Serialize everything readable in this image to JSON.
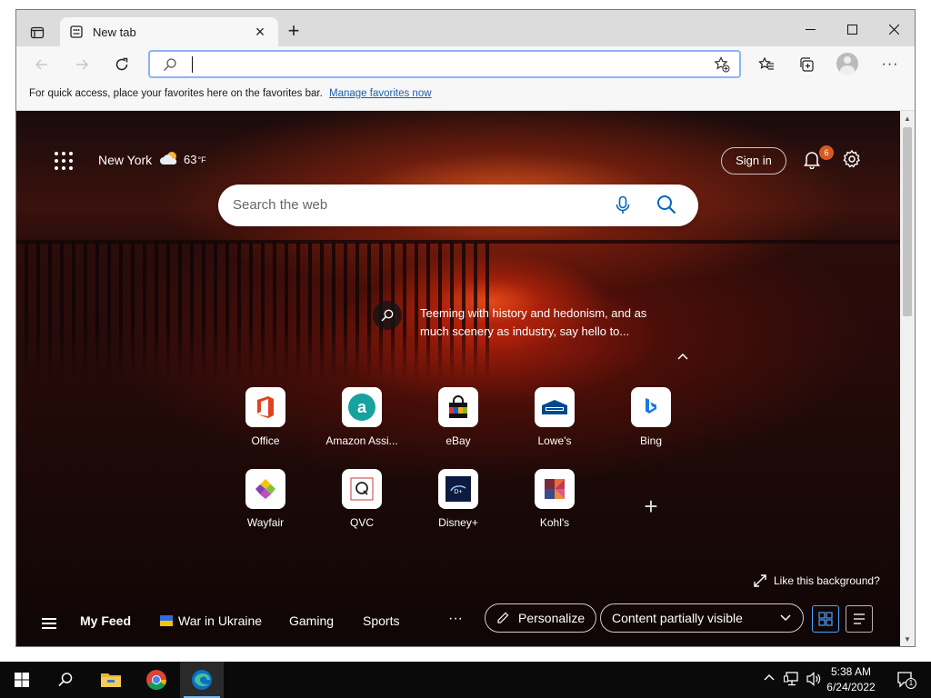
{
  "browser": {
    "tab_title": "New tab",
    "address_value": "",
    "favbar_text": "For quick access, place your favorites here on the favorites bar.",
    "favbar_link": "Manage favorites now"
  },
  "newtab": {
    "city": "New York",
    "temperature": "63",
    "temp_unit": "°F",
    "sign_in": "Sign in",
    "notification_count": "6",
    "search_placeholder": "Search the web",
    "fact_text": "Teeming with history and hedonism, and as much scenery as industry, say hello to...",
    "like_background": "Like this background?",
    "quick_links": [
      {
        "label": "Office",
        "icon": "office-icon"
      },
      {
        "label": "Amazon Assi...",
        "icon": "amazon-icon"
      },
      {
        "label": "eBay",
        "icon": "ebay-icon"
      },
      {
        "label": "Lowe's",
        "icon": "lowes-icon"
      },
      {
        "label": "Bing",
        "icon": "bing-icon"
      },
      {
        "label": "Wayfair",
        "icon": "wayfair-icon"
      },
      {
        "label": "QVC",
        "icon": "qvc-icon"
      },
      {
        "label": "Disney+",
        "icon": "disney-icon"
      },
      {
        "label": "Kohl's",
        "icon": "kohls-icon"
      }
    ],
    "feed": {
      "my_feed": "My Feed",
      "topics": [
        "War in Ukraine",
        "Gaming",
        "Sports"
      ],
      "more": "···",
      "personalize": "Personalize",
      "content_visibility": "Content partially visible"
    }
  },
  "taskbar": {
    "time": "5:38 AM",
    "date": "6/24/2022",
    "notification_count": "1"
  },
  "colors": {
    "accent": "#0067c0",
    "badge": "#d65a1e"
  }
}
